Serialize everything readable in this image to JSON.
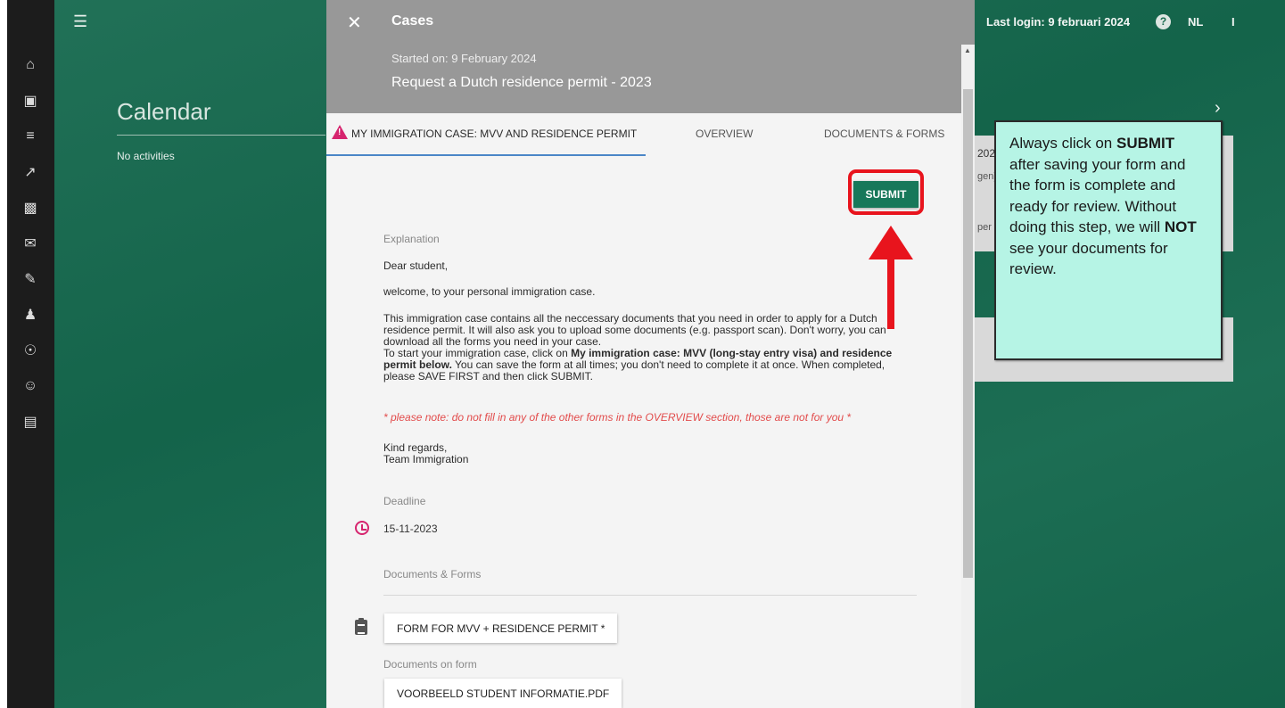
{
  "header": {
    "last_login": "Last login: 9 februari 2024",
    "help_label": "?",
    "language": "NL",
    "extra": "I"
  },
  "calendar": {
    "title": "Calendar",
    "empty": "No activities"
  },
  "background_cards": {
    "card_a_line1": "202",
    "card_a_line2": "gen)",
    "card_a_line3": "per"
  },
  "callout": {
    "p1": "Always click on ",
    "b1": "SUBMIT",
    "p2": " after saving your form and the form is complete and ready for review. Without doing this step, we will ",
    "b2": "NOT",
    "p3": " see your documents for review."
  },
  "panel": {
    "close_label": "✕",
    "title": "Cases",
    "started": "Started on: 9 February 2024",
    "request": "Request a Dutch residence permit - 2023",
    "tabs": [
      {
        "label": "MY IMMIGRATION CASE: MVV AND RESIDENCE PERMIT"
      },
      {
        "label": "OVERVIEW"
      },
      {
        "label": "DOCUMENTS & FORMS"
      }
    ],
    "submit_label": "SUBMIT",
    "explanation_label": "Explanation",
    "greeting": "Dear student,",
    "welcome": "welcome, to your personal immigration case.",
    "body_1": "This immigration case contains all the neccessary documents that you need in order to apply for a Dutch",
    "body_2": "residence permit. It will also ask you to upload some documents (e.g. passport scan). Don't worry, you can",
    "body_3": "download all the forms you need in your case.",
    "body_4a": "To start your immigration case, click on ",
    "body_4b": "My immigration case: MVV (long-stay entry visa) and residence",
    "body_5a": "permit below.",
    "body_5b": " You can save the form at all times; you don't need to complete it at once. When completed,",
    "body_6": "please SAVE FIRST and then click SUBMIT.",
    "note": "* please note: do not fill in any of the other forms in the OVERVIEW section, those are not for you *",
    "regards_1": "Kind regards,",
    "regards_2": "Team Immigration",
    "deadline_label": "Deadline",
    "deadline_value": "15-11-2023",
    "docs_label": "Documents & Forms",
    "form_button": "FORM FOR MVV + RESIDENCE PERMIT *",
    "docs_on_form_label": "Documents on form",
    "doc_button": "VOORBEELD STUDENT INFORMATIE.PDF"
  },
  "colors": {
    "brand_green": "#15694e",
    "submit_green": "#17785a",
    "highlight_red": "#e8141d",
    "callout_bg": "#b6f4e5",
    "warning_pink": "#d6246e"
  }
}
